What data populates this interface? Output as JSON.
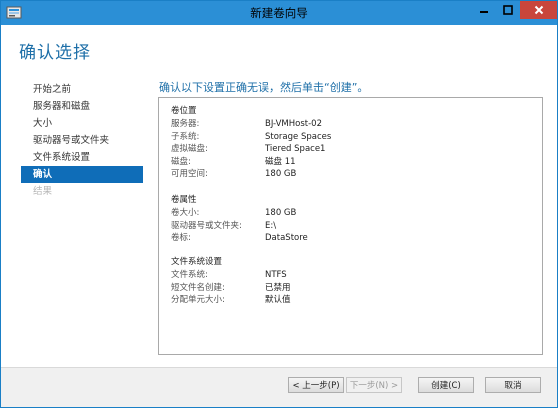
{
  "window": {
    "title": "新建卷向导",
    "heading": "确认选择",
    "colors": {
      "titlebar": "#2b8fd6",
      "accent": "#1e6fa8",
      "active_nav": "#0f6db8",
      "close": "#c9463c"
    }
  },
  "nav": {
    "items": [
      {
        "label": "开始之前",
        "state": "normal"
      },
      {
        "label": "服务器和磁盘",
        "state": "normal"
      },
      {
        "label": "大小",
        "state": "normal"
      },
      {
        "label": "驱动器号或文件夹",
        "state": "normal"
      },
      {
        "label": "文件系统设置",
        "state": "normal"
      },
      {
        "label": "确认",
        "state": "active"
      },
      {
        "label": "结果",
        "state": "disabled"
      }
    ]
  },
  "main": {
    "instruction": "确认以下设置正确无误，然后单击“创建”。",
    "sections": [
      {
        "title": "卷位置",
        "rows": [
          {
            "key": "服务器:",
            "value": "BJ-VMHost-02"
          },
          {
            "key": "子系统:",
            "value": "Storage Spaces"
          },
          {
            "key": "虚拟磁盘:",
            "value": "Tiered Space1"
          },
          {
            "key": "磁盘:",
            "value": "磁盘 11"
          },
          {
            "key": "可用空间:",
            "value": "180 GB"
          }
        ]
      },
      {
        "title": "卷属性",
        "rows": [
          {
            "key": "卷大小:",
            "value": "180 GB"
          },
          {
            "key": "驱动器号或文件夹:",
            "value": "E:\\"
          },
          {
            "key": "卷标:",
            "value": "DataStore"
          }
        ]
      },
      {
        "title": "文件系统设置",
        "rows": [
          {
            "key": "文件系统:",
            "value": "NTFS"
          },
          {
            "key": "短文件名创建:",
            "value": "已禁用"
          },
          {
            "key": "分配单元大小:",
            "value": "默认值"
          }
        ]
      }
    ]
  },
  "buttons": {
    "prev": "< 上一步(P)",
    "next": "下一步(N) >",
    "create": "创建(C)",
    "cancel": "取消"
  }
}
